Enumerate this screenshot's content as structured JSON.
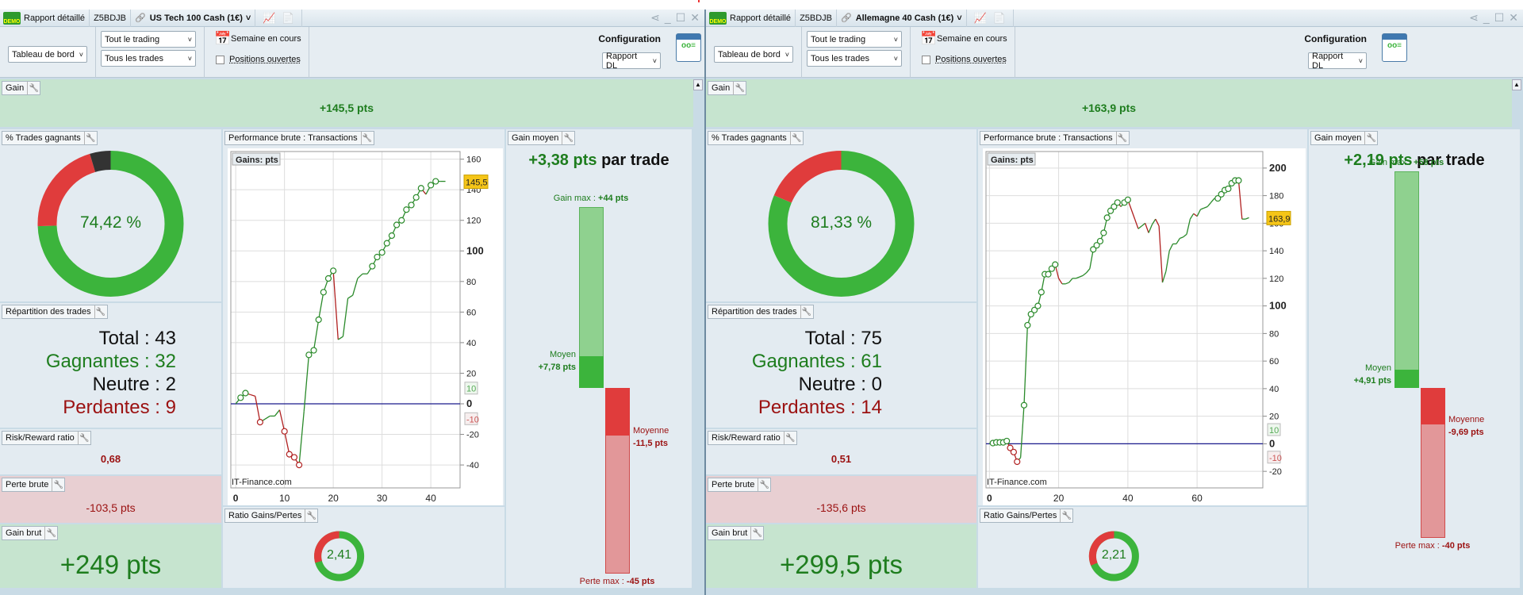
{
  "panels": [
    {
      "title_bar": {
        "app": "Rapport détaillé",
        "account": "Z5BDJB",
        "instrument": "US Tech 100 Cash (1€)",
        "demo_badge": "DEMO"
      },
      "toolbar": {
        "view": "Tableau de bord",
        "scope": "Tout le trading",
        "trades": "Tous les trades",
        "period": "Semaine en cours",
        "open_positions": "Positions ouvertes",
        "open_positions_checked": false,
        "config_label": "Configuration",
        "config": "Rapport DL"
      },
      "gain": {
        "label": "Gain",
        "value": "+145,5 pts"
      },
      "win_rate": {
        "label": "% Trades gagnants",
        "value": "74,42 %",
        "win_pct": 74.42,
        "neutral_pct": 4.65,
        "loss_pct": 20.93
      },
      "distribution": {
        "label": "Répartition des trades",
        "total_label": "Total",
        "total": "43",
        "win_label": "Gagnantes",
        "win": "32",
        "neutral_label": "Neutre",
        "neutral": "2",
        "loss_label": "Perdantes",
        "loss": "9"
      },
      "risk_reward": {
        "label": "Risk/Reward ratio",
        "value": "0,68"
      },
      "gross_loss": {
        "label": "Perte brute",
        "value": "-103,5 pts"
      },
      "gross_gain": {
        "label": "Gain brut",
        "value": "+249 pts"
      },
      "performance": {
        "label": "Performance brute : Transactions"
      },
      "ratio": {
        "label": "Ratio Gains/Pertes",
        "value": "2,41",
        "ratio": 2.41
      },
      "avg_gain": {
        "label": "Gain moyen",
        "value": "+3,38 pts",
        "suffix": "par trade",
        "max_gain_label": "Gain max :",
        "max_gain": "+44 pts",
        "avg_win_label": "Moyen",
        "avg_win": "+7,78 pts",
        "avg_loss_label": "Moyenne",
        "avg_loss": "-11,5 pts",
        "max_loss_label": "Perte max :",
        "max_loss": "-45 pts",
        "values": {
          "max_gain": 44,
          "avg_win": 7.78,
          "avg_loss": -11.5,
          "max_loss": -45
        }
      }
    },
    {
      "title_bar": {
        "app": "Rapport détaillé",
        "account": "Z5BDJB",
        "instrument": "Allemagne 40 Cash (1€)",
        "demo_badge": "DEMO"
      },
      "toolbar": {
        "view": "Tableau de bord",
        "scope": "Tout le trading",
        "trades": "Tous les trades",
        "period": "Semaine en cours",
        "open_positions": "Positions ouvertes",
        "open_positions_checked": false,
        "config_label": "Configuration",
        "config": "Rapport DL"
      },
      "gain": {
        "label": "Gain",
        "value": "+163,9 pts"
      },
      "win_rate": {
        "label": "% Trades gagnants",
        "value": "81,33 %",
        "win_pct": 81.33,
        "neutral_pct": 0,
        "loss_pct": 18.67
      },
      "distribution": {
        "label": "Répartition des trades",
        "total_label": "Total",
        "total": "75",
        "win_label": "Gagnantes",
        "win": "61",
        "neutral_label": "Neutre",
        "neutral": "0",
        "loss_label": "Perdantes",
        "loss": "14"
      },
      "risk_reward": {
        "label": "Risk/Reward ratio",
        "value": "0,51"
      },
      "gross_loss": {
        "label": "Perte brute",
        "value": "-135,6 pts"
      },
      "gross_gain": {
        "label": "Gain brut",
        "value": "+299,5 pts"
      },
      "performance": {
        "label": "Performance brute : Transactions"
      },
      "ratio": {
        "label": "Ratio Gains/Pertes",
        "value": "2,21",
        "ratio": 2.21
      },
      "avg_gain": {
        "label": "Gain moyen",
        "value": "+2,19 pts",
        "suffix": "par trade",
        "max_gain_label": "Gain max :",
        "max_gain": "+58 pts",
        "avg_win_label": "Moyen",
        "avg_win": "+4,91 pts",
        "avg_loss_label": "Moyenne",
        "avg_loss": "-9,69 pts",
        "max_loss_label": "Perte max :",
        "max_loss": "-40 pts",
        "values": {
          "max_gain": 58,
          "avg_win": 4.91,
          "avg_loss": -9.69,
          "max_loss": -40
        }
      }
    }
  ],
  "chart_data": [
    {
      "type": "line",
      "title": "Gains: pts",
      "watermark": "IT-Finance.com",
      "xlim": [
        -1,
        46
      ],
      "ylim": [
        -55,
        165
      ],
      "x_ticks": [
        0,
        10,
        20,
        30,
        40
      ],
      "y_ticks": [
        -40,
        -20,
        0,
        20,
        40,
        60,
        80,
        100,
        120,
        140,
        160
      ],
      "grid": true,
      "threshold_labels": [
        "10",
        "-10"
      ],
      "last_value_label": "145,5",
      "y": [
        0,
        4,
        7,
        6,
        5,
        -12,
        -10,
        -8,
        -8,
        -4,
        -18,
        -33,
        -35,
        -40,
        -5,
        32,
        35,
        55,
        73,
        82,
        87,
        42,
        44,
        69,
        71,
        82,
        85,
        85,
        90,
        96,
        99,
        105,
        110,
        117,
        120,
        127,
        130,
        135,
        141,
        137,
        143,
        145.5,
        145.5,
        145.5
      ],
      "markers_up": [
        1,
        2,
        15,
        16,
        17,
        18,
        19,
        20,
        28,
        29,
        30,
        31,
        32,
        33,
        34,
        35,
        36,
        37,
        38,
        40,
        41
      ],
      "markers_down": [
        5,
        10,
        11,
        12,
        13
      ]
    },
    {
      "type": "line",
      "title": "Gains: pts",
      "watermark": "IT-Finance.com",
      "xlim": [
        -1,
        79
      ],
      "ylim": [
        -32,
        212
      ],
      "x_ticks": [
        0,
        20,
        40,
        60
      ],
      "y_ticks": [
        -20,
        0,
        20,
        40,
        60,
        80,
        100,
        120,
        140,
        160,
        180,
        200
      ],
      "grid": true,
      "threshold_labels": [
        "10",
        "-10"
      ],
      "last_value_label": "163,9",
      "y": [
        0,
        0.5,
        1,
        1,
        1,
        2,
        -3,
        -6,
        -13,
        -10,
        28,
        86,
        94,
        97,
        100,
        110,
        123,
        123,
        127,
        130,
        120,
        116,
        116,
        117,
        120,
        120,
        121,
        122,
        124,
        127,
        141,
        144,
        147,
        153,
        164,
        169,
        172,
        175,
        172,
        175,
        177,
        170,
        163,
        156,
        158,
        160,
        153,
        159,
        163,
        158,
        117,
        125,
        140,
        145,
        145,
        149,
        150,
        152,
        163,
        167,
        165,
        170,
        171,
        172,
        175,
        178,
        178,
        181,
        184,
        185,
        189,
        191,
        191,
        163,
        163,
        164
      ],
      "markers_up": [
        1,
        2,
        3,
        4,
        5,
        10,
        11,
        12,
        13,
        14,
        15,
        16,
        17,
        18,
        19,
        30,
        31,
        32,
        33,
        34,
        35,
        36,
        37,
        39,
        40,
        66,
        67,
        68,
        69,
        70,
        71,
        72
      ],
      "markers_down": [
        6,
        7,
        8
      ]
    }
  ],
  "colors": {
    "green": "#3cb43c",
    "dark_green": "#1e7d1e",
    "red": "#e03c3c",
    "dark_red": "#9b1111",
    "neutral": "#333333",
    "gain_bg": "#c6e4cf",
    "loss_bg": "#e8cfd2",
    "zero_line": "#1a1a8c",
    "last_value_bg": "#f5c518"
  }
}
